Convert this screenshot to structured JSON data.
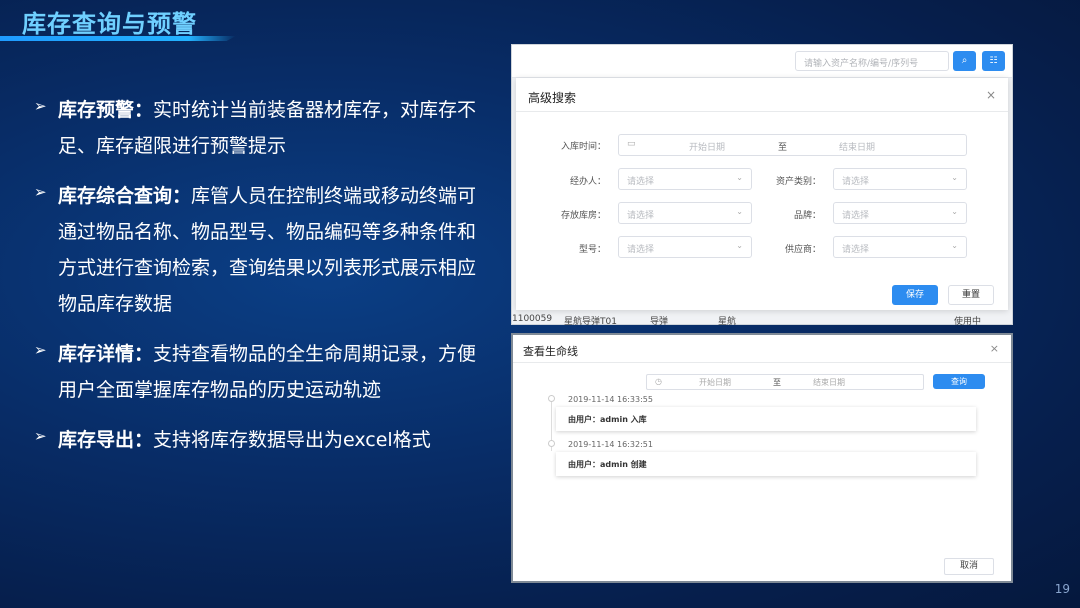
{
  "slide": {
    "title": "库存查询与预警",
    "page_number": "19"
  },
  "bullets": [
    {
      "bold": "库存预警：",
      "text": "实时统计当前装备器材库存，对库存不足、库存超限进行预警提示"
    },
    {
      "bold": "库存综合查询：",
      "text": "库管人员在控制终端或移动终端可通过物品名称、物品型号、物品编码等多种条件和方式进行查询检索，查询结果以列表形式展示相应物品库存数据"
    },
    {
      "bold": "库存详情：",
      "text": "支持查看物品的全生命周期记录，方便用户全面掌握库存物品的历史运动轨迹"
    },
    {
      "bold": "库存导出：",
      "text": "支持将库存数据导出为excel格式"
    }
  ],
  "search_panel": {
    "search_placeholder": "请输入资产名称/编号/序列号",
    "dialog_title": "高级搜索",
    "close": "×",
    "fields": {
      "in_time_label": "入库时间：",
      "start_date": "开始日期",
      "to": "至",
      "end_date": "结束日期",
      "handler_label": "经办人：",
      "asset_type_label": "资产类别：",
      "warehouse_label": "存放库房：",
      "brand_label": "品牌：",
      "model_label": "型号：",
      "supplier_label": "供应商：",
      "select_placeholder": "请选择"
    },
    "save_label": "保存",
    "reset_label": "重置",
    "table_row": {
      "code": "1100059",
      "name": "星航导弹T01",
      "type": "导弹",
      "brand": "星航",
      "status": "使用中"
    }
  },
  "lifecycle_panel": {
    "title": "查看生命线",
    "close": "×",
    "start_date": "开始日期",
    "to": "至",
    "end_date": "结束日期",
    "query_label": "查询",
    "events": [
      {
        "time": "2019-11-14 16:33:55",
        "text": "由用户：admin 入库"
      },
      {
        "time": "2019-11-14 16:32:51",
        "text": "由用户：admin 创建"
      }
    ],
    "cancel_label": "取消"
  },
  "colors": {
    "background": "#082d68",
    "title": "#6fd0ff",
    "accent": "#2d8cf0"
  }
}
